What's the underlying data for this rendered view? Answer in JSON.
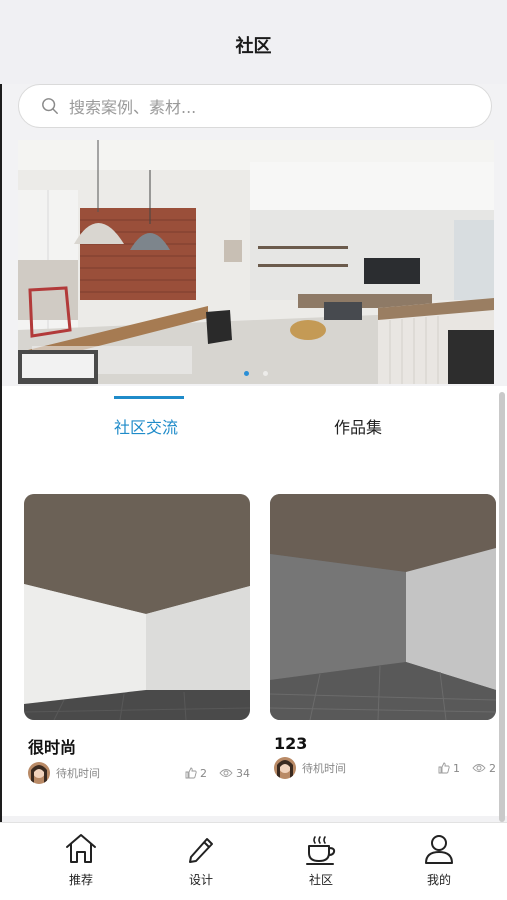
{
  "header": {
    "title": "社区"
  },
  "search": {
    "placeholder": "搜索案例、素材..."
  },
  "banner": {
    "slides": 2,
    "active_index": 0,
    "accent": "#2a8fd6"
  },
  "tabs": [
    {
      "label": "社区交流",
      "active": true
    },
    {
      "label": "作品集",
      "active": false
    }
  ],
  "accent_color": "#1f8bc9",
  "cards": [
    {
      "title": "很时尚",
      "author": "待机时间",
      "likes": "2",
      "views": "34"
    },
    {
      "title": "123",
      "author": "待机时间",
      "likes": "1",
      "views": "2"
    }
  ],
  "tabbar": [
    {
      "label": "推荐",
      "icon": "home-icon"
    },
    {
      "label": "设计",
      "icon": "pencil-icon"
    },
    {
      "label": "社区",
      "icon": "coffee-cup-icon"
    },
    {
      "label": "我的",
      "icon": "user-icon"
    }
  ]
}
